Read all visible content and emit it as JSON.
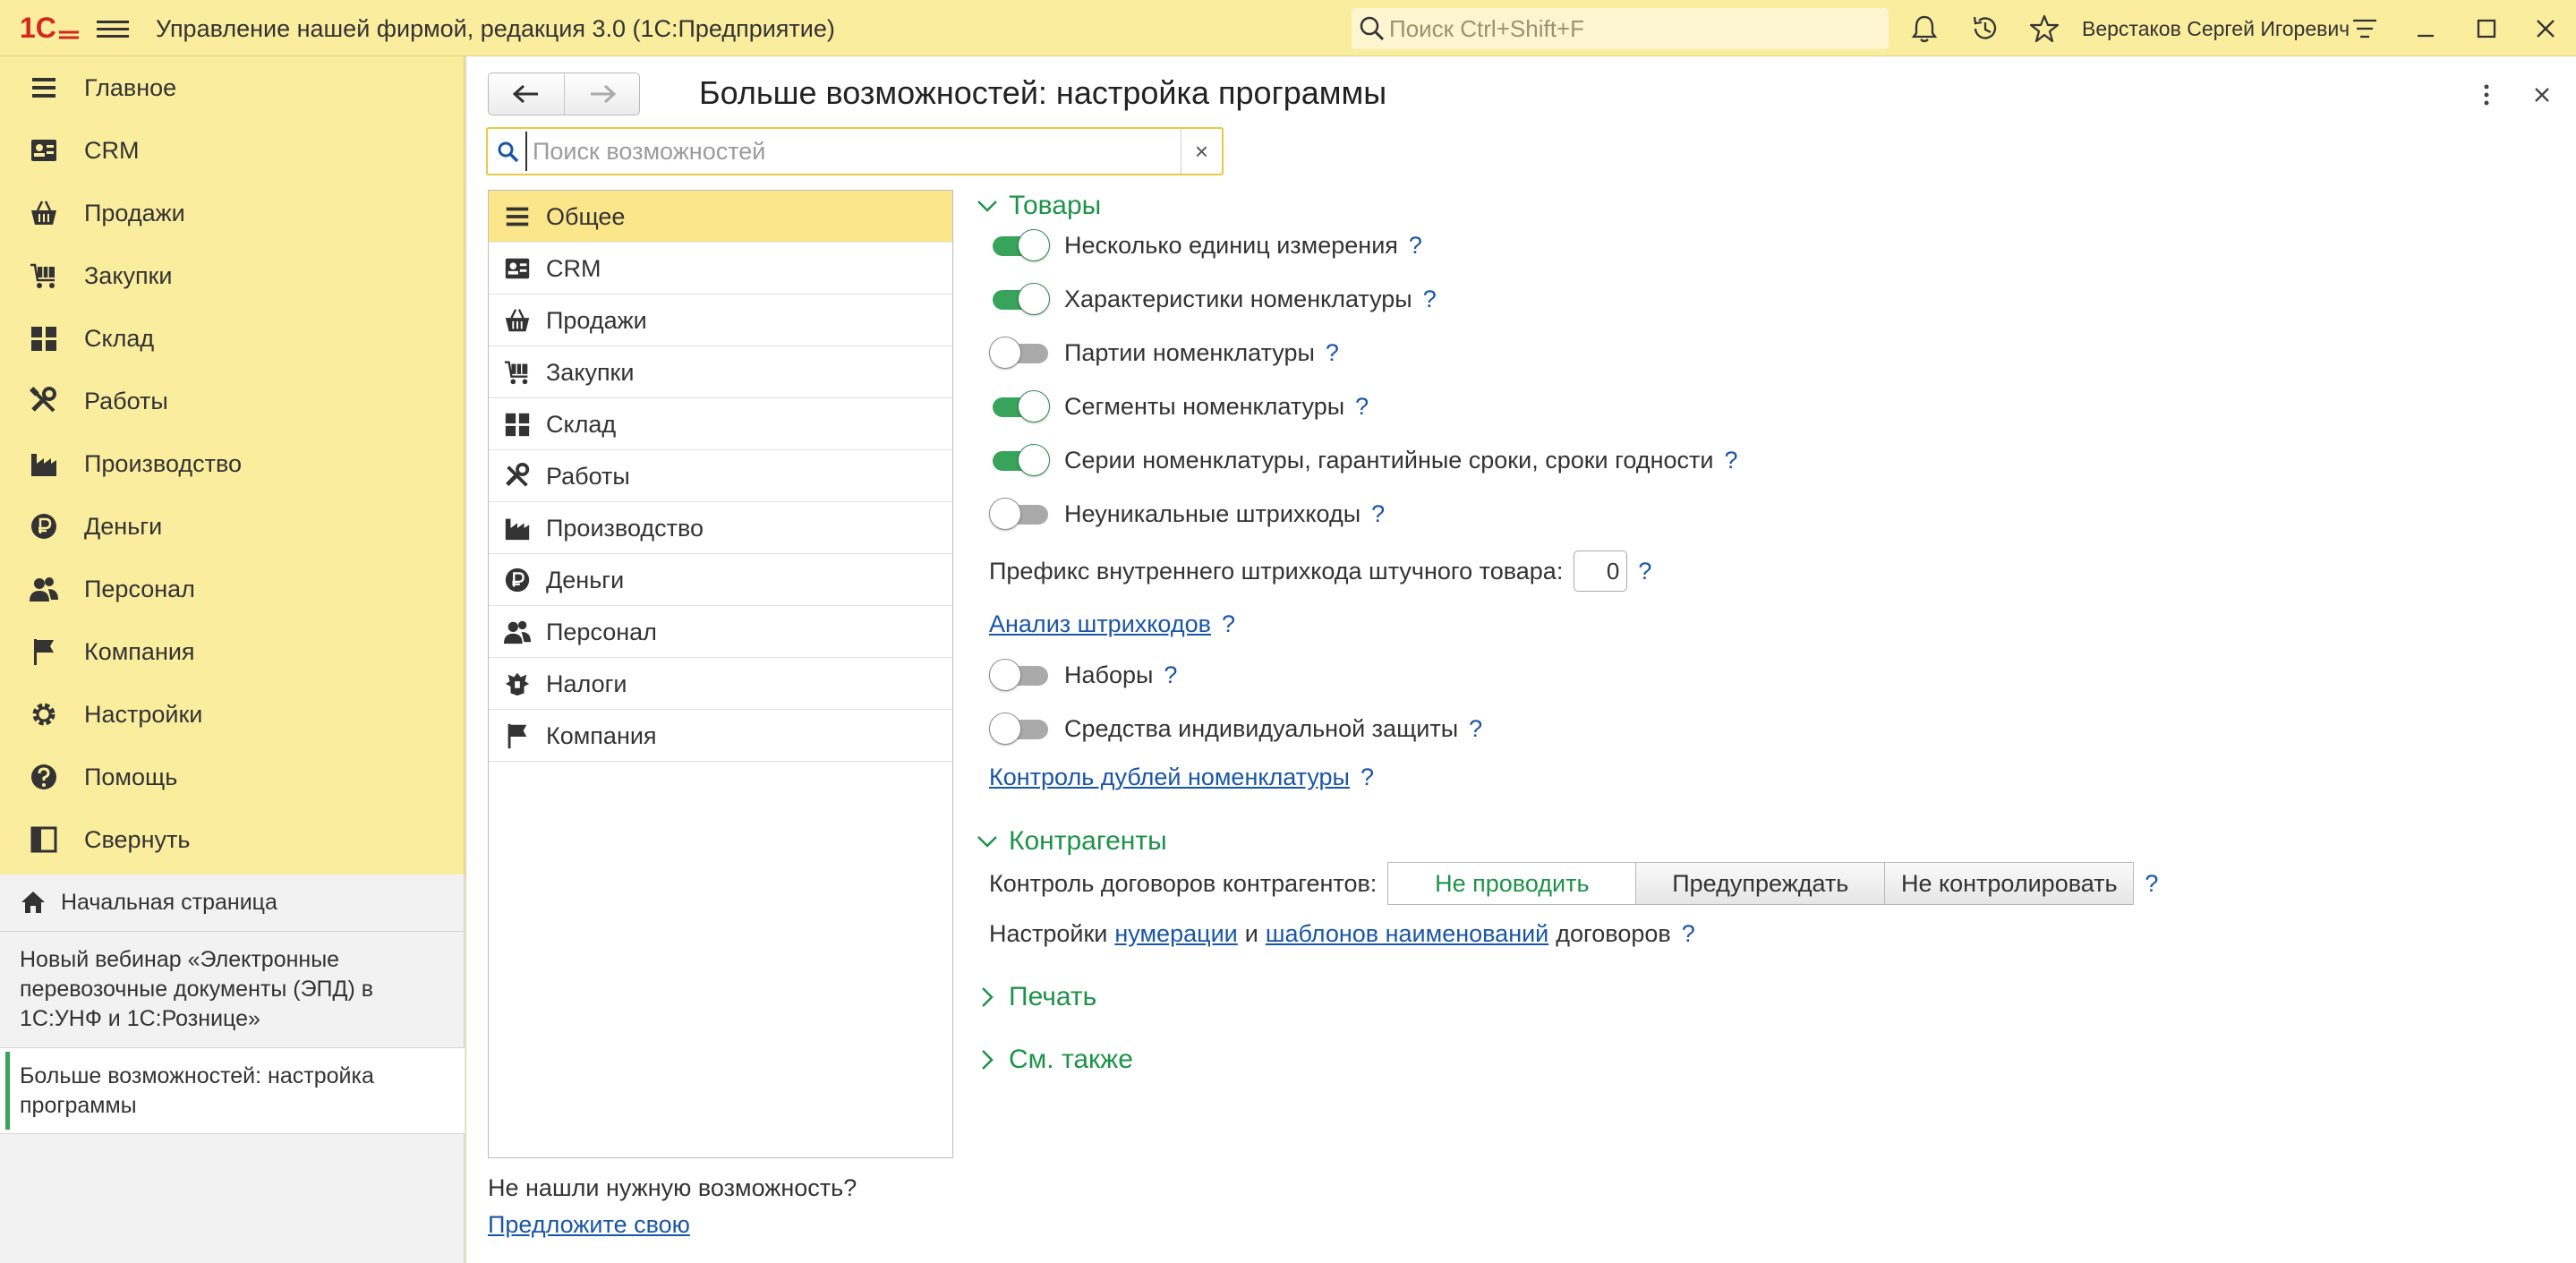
{
  "titlebar": {
    "app_title": "Управление нашей фирмой, редакция 3.0  (1С:Предприятие)",
    "search_placeholder": "Поиск Ctrl+Shift+F",
    "user_name": "Верстаков Сергей Игоревич"
  },
  "nav": {
    "items": [
      {
        "label": "Главное",
        "icon": "list-icon"
      },
      {
        "label": "CRM",
        "icon": "contact-card-icon"
      },
      {
        "label": "Продажи",
        "icon": "basket-icon"
      },
      {
        "label": "Закупки",
        "icon": "cart-icon"
      },
      {
        "label": "Склад",
        "icon": "warehouse-icon"
      },
      {
        "label": "Работы",
        "icon": "tools-icon"
      },
      {
        "label": "Производство",
        "icon": "factory-icon"
      },
      {
        "label": "Деньги",
        "icon": "ruble-icon"
      },
      {
        "label": "Персонал",
        "icon": "people-icon"
      },
      {
        "label": "Компания",
        "icon": "flag-icon"
      },
      {
        "label": "Настройки",
        "icon": "gear-icon"
      },
      {
        "label": "Помощь",
        "icon": "help-icon"
      },
      {
        "label": "Свернуть",
        "icon": "collapse-panel-icon"
      }
    ]
  },
  "windows": {
    "home": "Начальная страница",
    "webinar": "Новый вебинар «Электронные перевозочные документы (ЭПД) в 1С:УНФ и 1С:Рознице»",
    "current": "Больше возможностей: настройка программы"
  },
  "form": {
    "title": "Больше возможностей: настройка программы",
    "search_placeholder": "Поиск возможностей",
    "clear_label": "×",
    "sections": [
      {
        "label": "Общее",
        "icon": "list-icon"
      },
      {
        "label": "CRM",
        "icon": "contact-card-icon"
      },
      {
        "label": "Продажи",
        "icon": "basket-icon"
      },
      {
        "label": "Закупки",
        "icon": "cart-icon"
      },
      {
        "label": "Склад",
        "icon": "warehouse-icon"
      },
      {
        "label": "Работы",
        "icon": "tools-icon"
      },
      {
        "label": "Производство",
        "icon": "factory-icon"
      },
      {
        "label": "Деньги",
        "icon": "ruble-icon"
      },
      {
        "label": "Персонал",
        "icon": "people-icon"
      },
      {
        "label": "Налоги",
        "icon": "emblem-icon"
      },
      {
        "label": "Компания",
        "icon": "flag-icon"
      }
    ],
    "hint_text": "Не нашли нужную возможность?",
    "hint_link": "Предложите свою"
  },
  "goods": {
    "title": "Товары",
    "options": [
      {
        "label": "Несколько единиц измерения",
        "enabled": true
      },
      {
        "label": "Характеристики номенклатуры",
        "enabled": true
      },
      {
        "label": "Партии номенклатуры",
        "enabled": false
      },
      {
        "label": "Сегменты номенклатуры",
        "enabled": true
      },
      {
        "label": "Серии номенклатуры, гарантийные сроки, сроки годности",
        "enabled": true
      },
      {
        "label": "Неуникальные штрихкоды",
        "enabled": false
      }
    ],
    "prefix_label": "Префикс внутреннего штрихкода штучного товара:",
    "prefix_value": "0",
    "barcode_analysis_link": "Анализ штрихкодов",
    "sets_label": "Наборы",
    "sets_enabled": false,
    "ppe_label": "Средства индивидуальной защиты",
    "ppe_enabled": false,
    "duplicates_link": "Контроль дублей номенклатуры",
    "help_mark": "?"
  },
  "counterparties": {
    "title": "Контрагенты",
    "contract_control_label": "Контроль договоров контрагентов:",
    "contract_control_options": [
      "Не проводить",
      "Предупреждать",
      "Не контролировать"
    ],
    "contract_control_selected": "Не проводить",
    "settings_prefix": "Настройки",
    "numbering_link": "нумерации",
    "and_text": "и",
    "templates_link": "шаблонов наименований",
    "settings_suffix": "договоров"
  },
  "print": {
    "title": "Печать"
  },
  "see_also": {
    "title": "См. также"
  },
  "colors": {
    "panel_yellow": "#fbed9e",
    "selected_yellow": "#fbe68b",
    "accent_green": "#37a35b",
    "group_green": "#1d9349",
    "link_blue": "#1a56a6"
  }
}
